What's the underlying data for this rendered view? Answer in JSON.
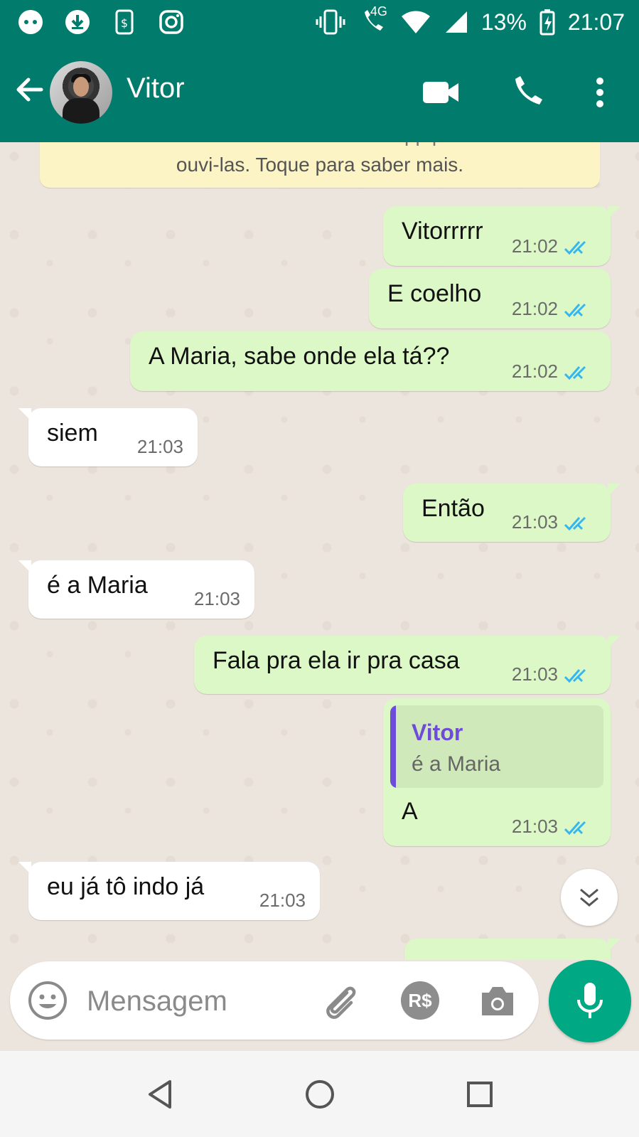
{
  "status_bar": {
    "network": "4G",
    "battery": "13%",
    "time": "21:07"
  },
  "header": {
    "contact_name": "Vitor"
  },
  "notice": {
    "line1": "conversa. Nem mesmo o WhatsApp pode ler ou",
    "line2": "ouvi-las. Toque para saber mais."
  },
  "messages": [
    {
      "dir": "out",
      "text": "Vitorrrrr",
      "time": "21:02"
    },
    {
      "dir": "out",
      "text": "E coelho",
      "time": "21:02"
    },
    {
      "dir": "out",
      "text": "A Maria, sabe onde ela tá??",
      "time": "21:02"
    },
    {
      "dir": "in",
      "text": "siem",
      "time": "21:03"
    },
    {
      "dir": "out",
      "text": "Então",
      "time": "21:03"
    },
    {
      "dir": "in",
      "text": "é a Maria",
      "time": "21:03"
    },
    {
      "dir": "out",
      "text": "Fala pra ela ir pra casa",
      "time": "21:03"
    },
    {
      "dir": "out",
      "text": "A",
      "time": "21:03",
      "quote": {
        "name": "Vitor",
        "text": "é a Maria"
      }
    },
    {
      "dir": "in",
      "text": "eu já tô indo já",
      "time": "21:03"
    }
  ],
  "composer": {
    "placeholder": "Mensagem",
    "pay_label": "R$"
  },
  "colors": {
    "header": "#017B6C",
    "outgoing_bubble": "#DCF8C6",
    "incoming_bubble": "#FFFFFF",
    "read_tick": "#34B7F1",
    "mic_button": "#00A884",
    "quote_accent": "#6E4BD8"
  },
  "icons": [
    "face-icon",
    "download-icon",
    "phone-sync-icon",
    "instagram-icon",
    "vibrate-icon",
    "wifi-icon",
    "signal-icon",
    "battery-icon",
    "back-arrow-icon",
    "video-call-icon",
    "voice-call-icon",
    "more-options-icon",
    "emoji-icon",
    "attach-icon",
    "camera-icon",
    "mic-icon",
    "chevron-down-icon",
    "nav-back-icon",
    "nav-home-icon",
    "nav-recents-icon"
  ]
}
